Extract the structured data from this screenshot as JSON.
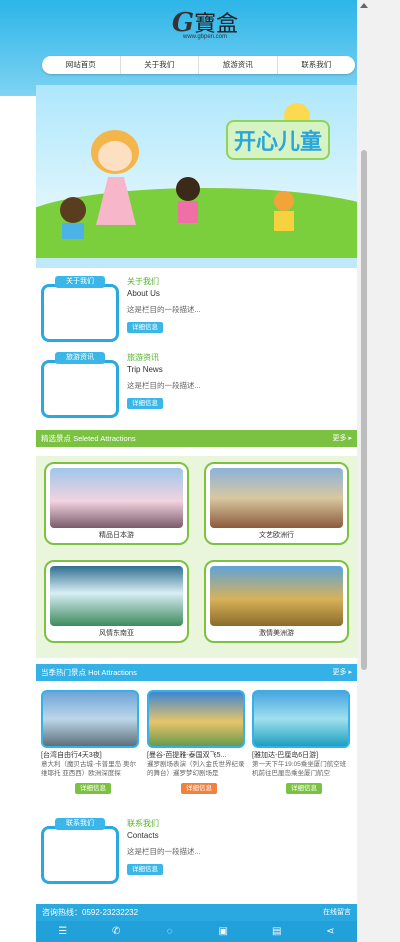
{
  "header": {
    "logo_letter": "G",
    "logo_text": "寶盒",
    "logo_url": "www.gbpen.com",
    "nav": [
      "网站首页",
      "关于我们",
      "旅游资讯",
      "联系我们"
    ]
  },
  "banner": {
    "title": "开心儿童"
  },
  "about": {
    "tag": "关于我们",
    "cn": "关于我们",
    "en": "About Us",
    "desc": "这是栏目的一段描述...",
    "btn": "详细信息"
  },
  "trip": {
    "tag": "旅游资讯",
    "cn": "旅游资讯",
    "en": "Trip News",
    "desc": "这是栏目的一段描述...",
    "btn": "详细信息"
  },
  "attractions": {
    "title": "精选景点 Seleted Attractions",
    "more": "更多 ▸",
    "items": [
      "精品日本游",
      "文艺欧洲行",
      "风情东南亚",
      "激情美洲游"
    ]
  },
  "hot": {
    "title": "当季热门景点 Hot Attractions",
    "more": "更多 ▸",
    "items": [
      {
        "title": "[台湾自由行4天3夜]",
        "desc": "意大利（魔贝古城·卡普里岛 奥尔维耶托 亚西西）欧洲深度探",
        "btn": "详细信息"
      },
      {
        "title": "[曼谷-芭提雅-泰国双飞5...",
        "desc": "暹罗剧场表演（列入金氏世界纪录的舞台）暹罗梦幻剧场是",
        "btn": "详细信息"
      },
      {
        "title": "[雅加达-巴厘岛6日游]",
        "desc": "第一天下午19:05乘坐厦门航空班机前往巴厘岛乘坐厦门航空",
        "btn": "详细信息"
      }
    ]
  },
  "contacts": {
    "tag": "联系我们",
    "cn": "联系我们",
    "en": "Contacts",
    "desc": "这是栏目的一段描述...",
    "btn": "详细信息"
  },
  "footer": {
    "hotline": "咨询热线：0592-23232232",
    "online": "在线留言"
  },
  "toolbar": {
    "icons": [
      "menu-icon",
      "phone-icon",
      "chat-icon",
      "message-icon",
      "map-icon",
      "share-icon"
    ]
  }
}
